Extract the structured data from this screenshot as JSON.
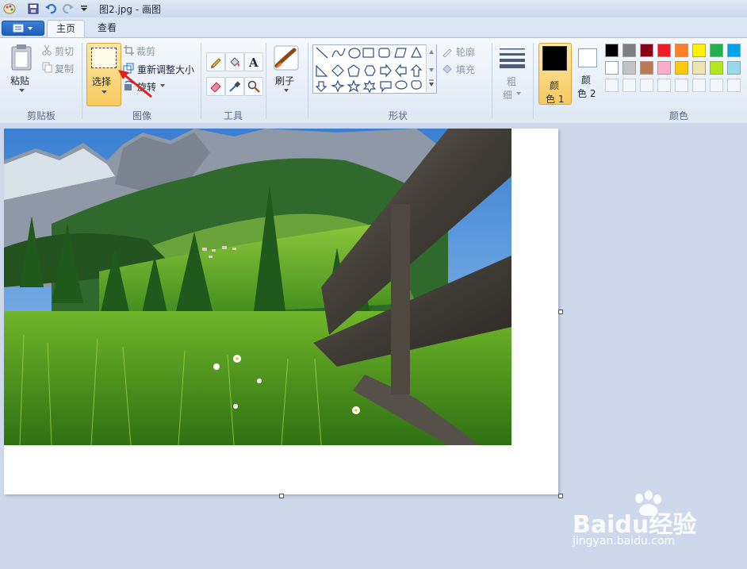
{
  "window": {
    "title": "图2.jpg - 画图"
  },
  "tabs": [
    {
      "label": "主页"
    },
    {
      "label": "查看"
    }
  ],
  "clipboard": {
    "paste": "粘贴",
    "cut": "剪切",
    "copy": "复制",
    "group": "剪贴板"
  },
  "image": {
    "select": "选择",
    "crop": "裁剪",
    "resize": "重新调整大小",
    "rotate": "旋转",
    "group": "图像"
  },
  "tools": {
    "group": "工具",
    "brushes": "刷子"
  },
  "shapes": {
    "outline": "轮廓",
    "fill": "填充",
    "group": "形状"
  },
  "size": {
    "label_1": "粗",
    "label_2": "细"
  },
  "colors": {
    "color1_a": "颜",
    "color1_b": "色 1",
    "color2_a": "颜",
    "color2_b": "色 2",
    "group": "颜色",
    "color1_value": "#000000",
    "color2_value": "#ffffff",
    "palette_row1": [
      "#000000",
      "#7f7f7f",
      "#880015",
      "#ed1c24",
      "#ff7f27",
      "#fff200",
      "#22b14c",
      "#00a2e8"
    ],
    "palette_row2": [
      "#ffffff",
      "#c3c3c3",
      "#b97a57",
      "#ffaec9",
      "#ffc90e",
      "#efe4b0",
      "#b5e61d",
      "#99d9ea"
    ]
  },
  "watermark": {
    "brand": "Baidu经验",
    "url": "jingyan.baidu.com"
  }
}
